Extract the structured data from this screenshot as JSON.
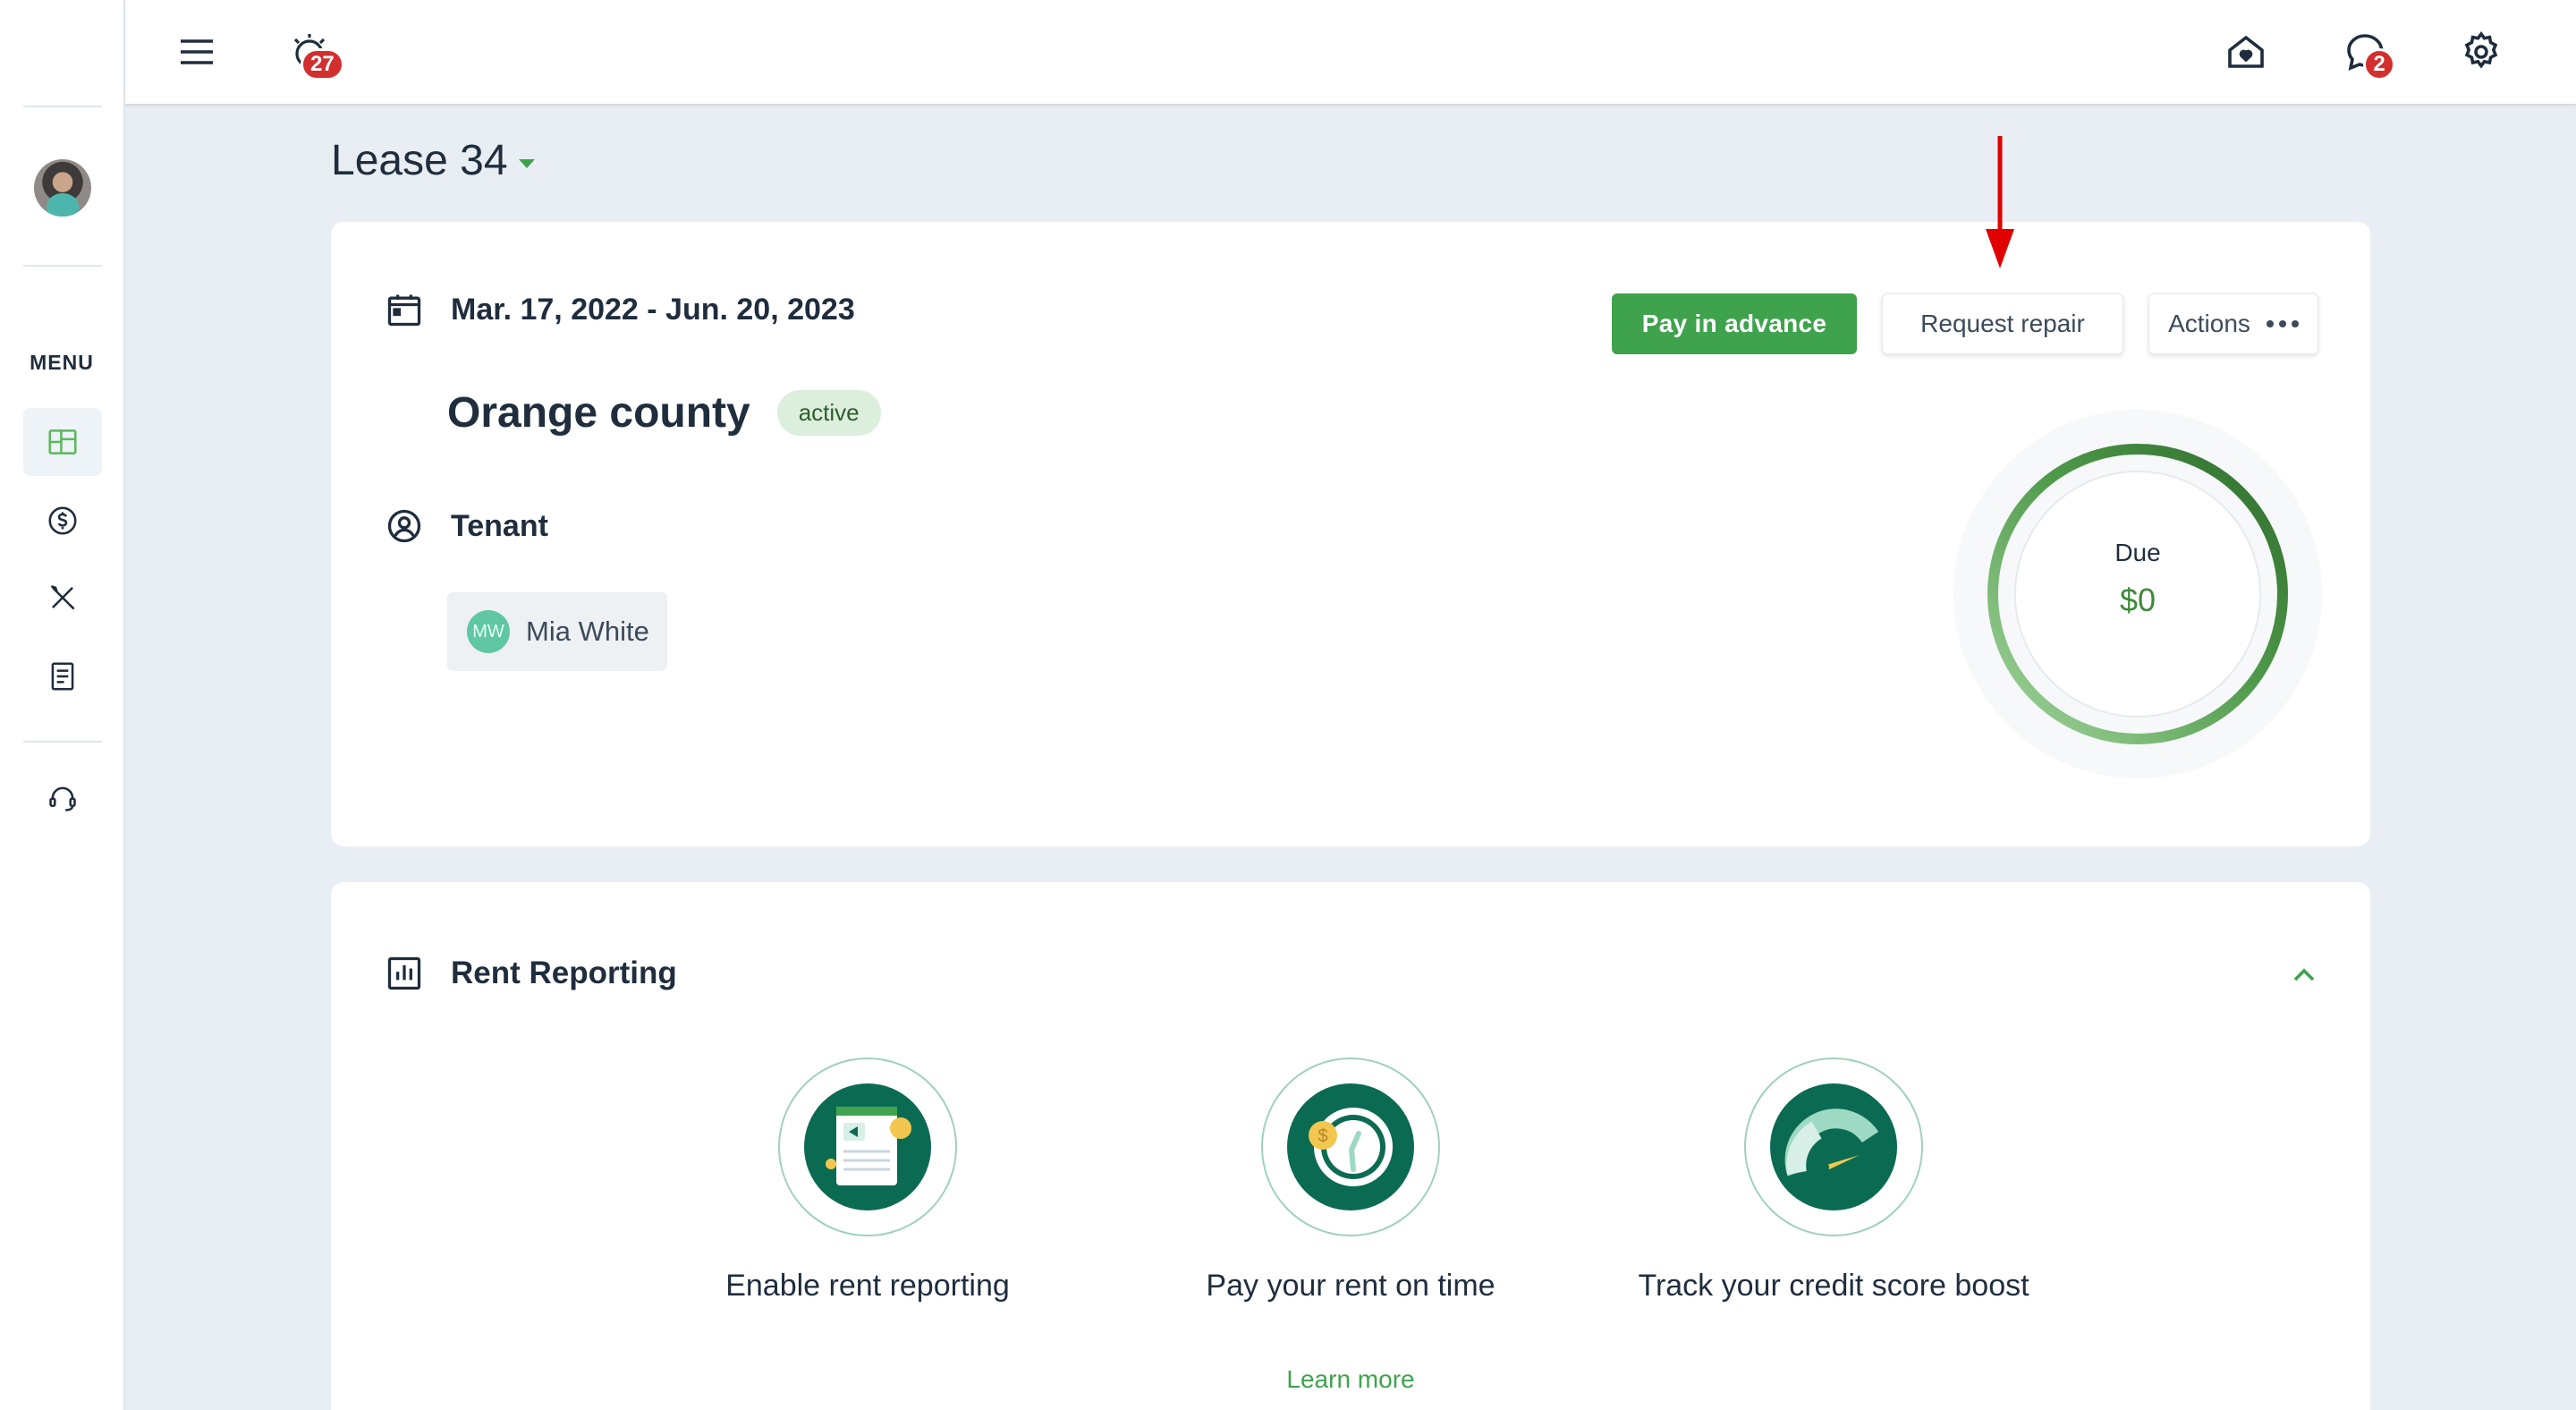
{
  "header": {
    "notifications_count": "27",
    "messages_count": "2"
  },
  "sidebar": {
    "menu_label": "MENU",
    "items": [
      {
        "icon": "dashboard-icon",
        "active": true
      },
      {
        "icon": "dollar-icon"
      },
      {
        "icon": "tools-icon"
      },
      {
        "icon": "document-icon"
      },
      {
        "icon": "headset-icon"
      }
    ]
  },
  "lease": {
    "title": "Lease 34",
    "dates": "Mar. 17, 2022 - Jun. 20, 2023",
    "property": "Orange county",
    "status": "active",
    "tenant_label": "Tenant",
    "tenant": {
      "initials": "MW",
      "name": "Mia White"
    },
    "buttons": {
      "pay_in_advance": "Pay in advance",
      "request_repair": "Request repair",
      "actions": "Actions"
    },
    "due": {
      "label": "Due",
      "value": "$0"
    }
  },
  "rent_reporting": {
    "title": "Rent Reporting",
    "features": [
      {
        "label": "Enable rent reporting"
      },
      {
        "label": "Pay your rent on time"
      },
      {
        "label": "Track your credit score boost"
      }
    ],
    "learn_more": "Learn more"
  },
  "colors": {
    "brand_green": "#3fa34d",
    "dark_green": "#0b6b52",
    "badge_red": "#d32f2f",
    "annotation_red": "#e00000"
  }
}
